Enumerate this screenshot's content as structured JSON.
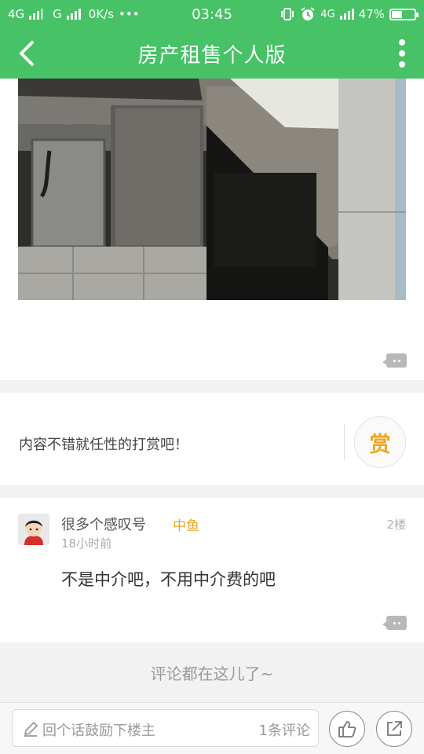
{
  "status_bar": {
    "network1": "4G",
    "network2": "G",
    "speed": "0K/s",
    "dots": "•••",
    "time": "03:45",
    "network3": "4G",
    "battery": "47%",
    "battery_level": 0.47
  },
  "nav": {
    "title": "房产租售个人版",
    "back_icon": "chevron-left-icon",
    "more_icon": "more-vertical-icon"
  },
  "reward": {
    "text": "内容不错就任性的打赏吧！",
    "button_label": "赏",
    "accent": "#f0a51d"
  },
  "reply": {
    "username": "很多个感叹号",
    "level": "中鱼",
    "floor": "2楼",
    "time": "18小时前",
    "content": "不是中介吧，不用中介费的吧"
  },
  "all_comments_label": "评论都在这儿了~",
  "bottom_bar": {
    "placeholder": "回个话鼓励下楼主",
    "comment_count": "1条评论",
    "like_icon": "thumbs-up-icon",
    "share_icon": "share-icon"
  },
  "colors": {
    "brand_green": "#47c266",
    "level_gold": "#e8a520"
  }
}
